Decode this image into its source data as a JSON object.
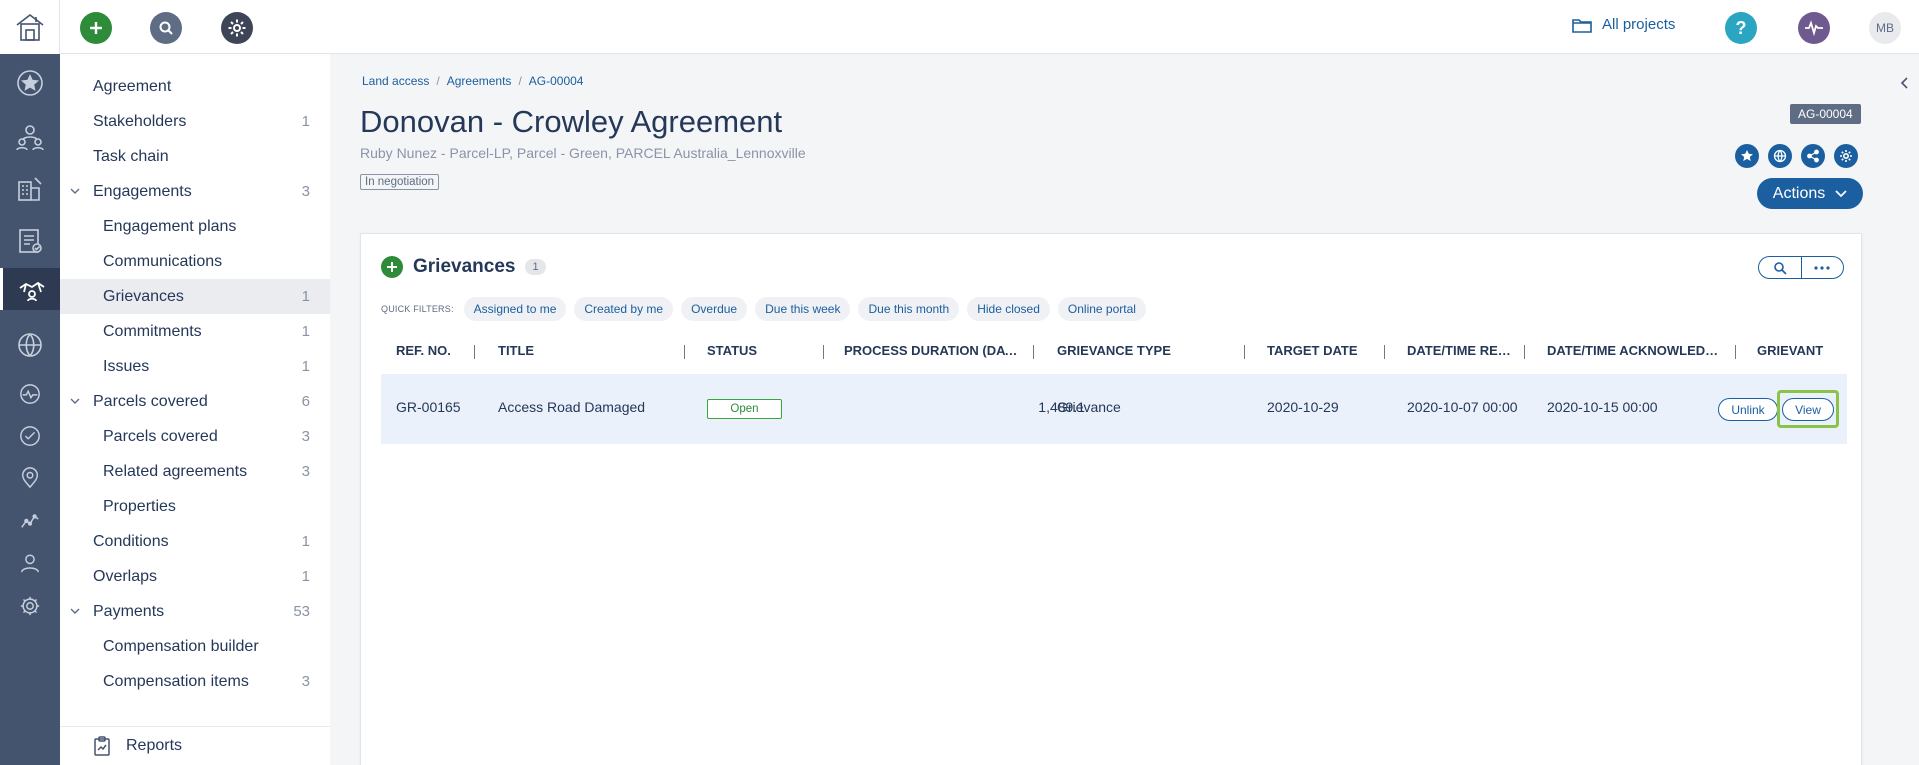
{
  "topbar": {
    "all_projects": "All projects",
    "avatar_initials": "MB"
  },
  "nav": {
    "items": [
      {
        "label": "Agreement",
        "count": ""
      },
      {
        "label": "Stakeholders",
        "count": "1"
      },
      {
        "label": "Task chain",
        "count": ""
      },
      {
        "label": "Engagements",
        "count": "3"
      },
      {
        "label": "Engagement plans",
        "count": ""
      },
      {
        "label": "Communications",
        "count": ""
      },
      {
        "label": "Grievances",
        "count": "1"
      },
      {
        "label": "Commitments",
        "count": "1"
      },
      {
        "label": "Issues",
        "count": "1"
      },
      {
        "label": "Parcels covered",
        "count": "6"
      },
      {
        "label": "Parcels covered",
        "count": "3"
      },
      {
        "label": "Related agreements",
        "count": "3"
      },
      {
        "label": "Properties",
        "count": ""
      },
      {
        "label": "Conditions",
        "count": "1"
      },
      {
        "label": "Overlaps",
        "count": "1"
      },
      {
        "label": "Payments",
        "count": "53"
      },
      {
        "label": "Compensation builder",
        "count": ""
      },
      {
        "label": "Compensation items",
        "count": "3"
      }
    ],
    "reports": "Reports"
  },
  "breadcrumb": [
    "Land access",
    "Agreements",
    "AG-00004"
  ],
  "page": {
    "title": "Donovan - Crowley Agreement",
    "subtitle": "Ruby Nunez - Parcel-LP, Parcel - Green, PARCEL Australia_Lennoxville",
    "status": "In negotiation",
    "ref_badge": "AG-00004",
    "actions_label": "Actions"
  },
  "grievances": {
    "title": "Grievances",
    "count": "1",
    "quick_filters_label": "QUICK FILTERS:",
    "quick_filters": [
      "Assigned to me",
      "Created by me",
      "Overdue",
      "Due this week",
      "Due this month",
      "Hide closed",
      "Online portal"
    ],
    "columns": [
      "REF. NO.",
      "TITLE",
      "STATUS",
      "PROCESS DURATION (DAYS)",
      "GRIEVANCE TYPE",
      "TARGET DATE",
      "DATE/TIME RECEIVED",
      "DATE/TIME ACKNOWLEDGED",
      "GRIEVANT"
    ],
    "row": {
      "ref": "GR-00165",
      "title": "Access Road Damaged",
      "status": "Open",
      "duration": "1,489.1",
      "type": "Grievance",
      "target_date": "2020-10-29",
      "received": "2020-10-07 00:00",
      "acknowledged": "2020-10-15 00:00",
      "unlink": "Unlink",
      "view": "View"
    }
  }
}
